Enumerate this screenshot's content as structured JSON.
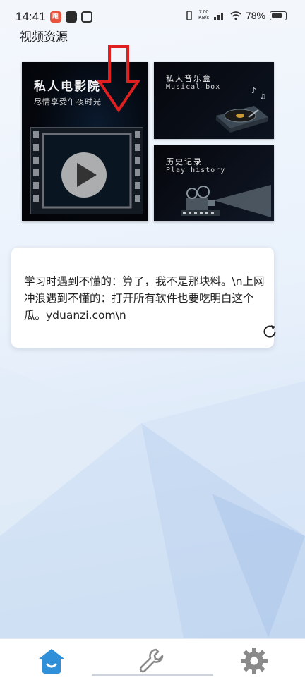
{
  "status_bar": {
    "time": "14:41",
    "app_badge": "跑",
    "speed_value": "7.00",
    "speed_unit": "KB/s",
    "battery": "78%"
  },
  "section": {
    "title": "视频资源"
  },
  "tiles": {
    "cinema": {
      "title": "私人电影院",
      "subtitle": "尽情享受午夜时光"
    },
    "music": {
      "title": "私人音乐盒",
      "subtitle": "Musical box"
    },
    "history": {
      "title": "历史记录",
      "subtitle": "Play history"
    }
  },
  "joke": {
    "text": "学习时遇到不懂的：算了，我不是那块料。\\n上网冲浪遇到不懂的：打开所有软件也要吃明白这个瓜。yduanzi.com\\n"
  },
  "nav": {
    "items": [
      {
        "icon": "home-icon",
        "active": true
      },
      {
        "icon": "wrench-icon",
        "active": false
      },
      {
        "icon": "gear-icon",
        "active": false
      }
    ]
  },
  "colors": {
    "accent": "#2f8fd8",
    "annotation_arrow": "#e02020",
    "inactive_icon": "#8a8a8a"
  }
}
